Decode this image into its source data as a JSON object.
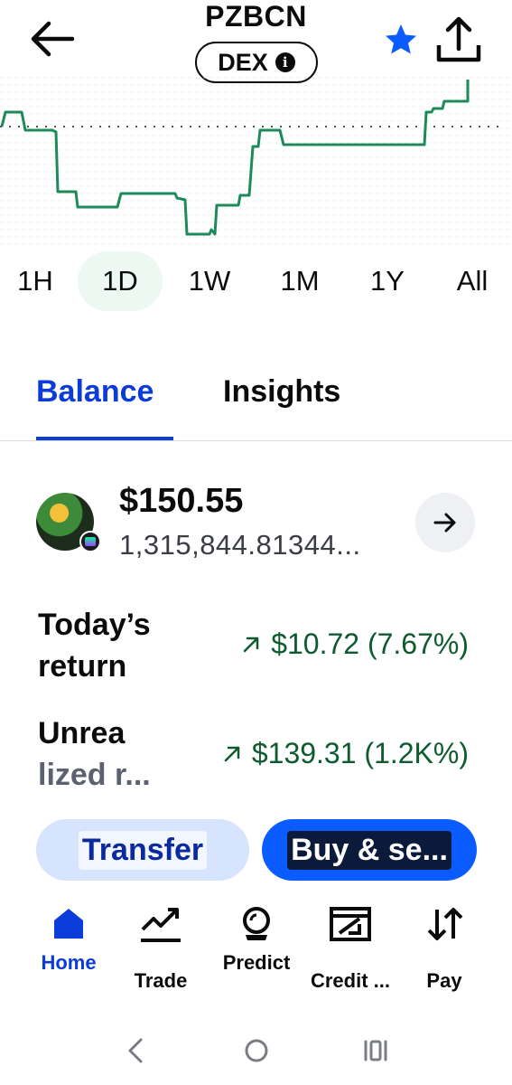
{
  "header": {
    "ticker": "PZBCN",
    "badge": "DEX",
    "badge_info": "i"
  },
  "chart": {
    "series_color": "#1e8a5a",
    "reference_line": "dotted"
  },
  "ranges": [
    {
      "label": "1H",
      "active": false
    },
    {
      "label": "1D",
      "active": true
    },
    {
      "label": "1W",
      "active": false
    },
    {
      "label": "1M",
      "active": false
    },
    {
      "label": "1Y",
      "active": false
    },
    {
      "label": "All",
      "active": false
    }
  ],
  "tabs": {
    "balance": "Balance",
    "insights": "Insights"
  },
  "balance": {
    "value": "$150.55",
    "amount": "1,315,844.81344..."
  },
  "stats": {
    "today_label_1": "Today’s",
    "today_label_2": "return",
    "today_value": "$10.72 (7.67%)",
    "unrealized_label_1": "Unrea",
    "unrealized_label_2": "lized r...",
    "unrealized_value": "$139.31 (1.2K%)"
  },
  "actions": {
    "transfer": "Transfer",
    "buy_sell": "Buy & se..."
  },
  "nav": {
    "home": "Home",
    "trade": "Trade",
    "predict": "Predict",
    "credit": "Credit ...",
    "pay": "Pay"
  },
  "colors": {
    "accent_blue": "#0b3bd9",
    "positive_green": "#0d5b2f",
    "star_blue": "#0b5cff"
  }
}
